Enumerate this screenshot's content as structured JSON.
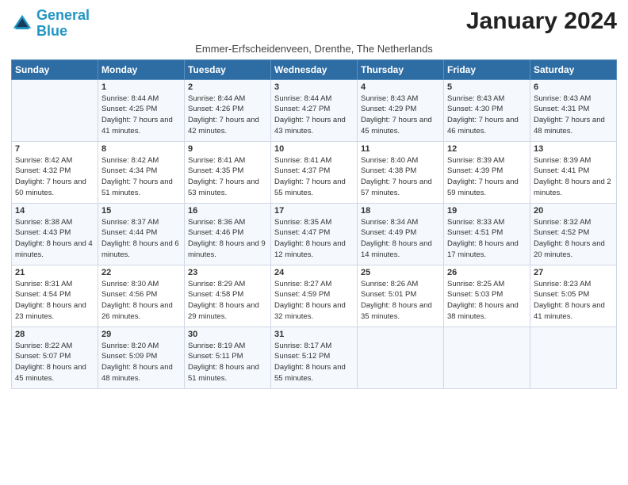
{
  "header": {
    "logo_general": "General",
    "logo_blue": "Blue",
    "month_title": "January 2024",
    "subtitle": "Emmer-Erfscheidenveen, Drenthe, The Netherlands"
  },
  "days_of_week": [
    "Sunday",
    "Monday",
    "Tuesday",
    "Wednesday",
    "Thursday",
    "Friday",
    "Saturday"
  ],
  "weeks": [
    [
      {
        "day": "",
        "sunrise": "",
        "sunset": "",
        "daylight": ""
      },
      {
        "day": "1",
        "sunrise": "Sunrise: 8:44 AM",
        "sunset": "Sunset: 4:25 PM",
        "daylight": "Daylight: 7 hours and 41 minutes."
      },
      {
        "day": "2",
        "sunrise": "Sunrise: 8:44 AM",
        "sunset": "Sunset: 4:26 PM",
        "daylight": "Daylight: 7 hours and 42 minutes."
      },
      {
        "day": "3",
        "sunrise": "Sunrise: 8:44 AM",
        "sunset": "Sunset: 4:27 PM",
        "daylight": "Daylight: 7 hours and 43 minutes."
      },
      {
        "day": "4",
        "sunrise": "Sunrise: 8:43 AM",
        "sunset": "Sunset: 4:29 PM",
        "daylight": "Daylight: 7 hours and 45 minutes."
      },
      {
        "day": "5",
        "sunrise": "Sunrise: 8:43 AM",
        "sunset": "Sunset: 4:30 PM",
        "daylight": "Daylight: 7 hours and 46 minutes."
      },
      {
        "day": "6",
        "sunrise": "Sunrise: 8:43 AM",
        "sunset": "Sunset: 4:31 PM",
        "daylight": "Daylight: 7 hours and 48 minutes."
      }
    ],
    [
      {
        "day": "7",
        "sunrise": "Sunrise: 8:42 AM",
        "sunset": "Sunset: 4:32 PM",
        "daylight": "Daylight: 7 hours and 50 minutes."
      },
      {
        "day": "8",
        "sunrise": "Sunrise: 8:42 AM",
        "sunset": "Sunset: 4:34 PM",
        "daylight": "Daylight: 7 hours and 51 minutes."
      },
      {
        "day": "9",
        "sunrise": "Sunrise: 8:41 AM",
        "sunset": "Sunset: 4:35 PM",
        "daylight": "Daylight: 7 hours and 53 minutes."
      },
      {
        "day": "10",
        "sunrise": "Sunrise: 8:41 AM",
        "sunset": "Sunset: 4:37 PM",
        "daylight": "Daylight: 7 hours and 55 minutes."
      },
      {
        "day": "11",
        "sunrise": "Sunrise: 8:40 AM",
        "sunset": "Sunset: 4:38 PM",
        "daylight": "Daylight: 7 hours and 57 minutes."
      },
      {
        "day": "12",
        "sunrise": "Sunrise: 8:39 AM",
        "sunset": "Sunset: 4:39 PM",
        "daylight": "Daylight: 7 hours and 59 minutes."
      },
      {
        "day": "13",
        "sunrise": "Sunrise: 8:39 AM",
        "sunset": "Sunset: 4:41 PM",
        "daylight": "Daylight: 8 hours and 2 minutes."
      }
    ],
    [
      {
        "day": "14",
        "sunrise": "Sunrise: 8:38 AM",
        "sunset": "Sunset: 4:43 PM",
        "daylight": "Daylight: 8 hours and 4 minutes."
      },
      {
        "day": "15",
        "sunrise": "Sunrise: 8:37 AM",
        "sunset": "Sunset: 4:44 PM",
        "daylight": "Daylight: 8 hours and 6 minutes."
      },
      {
        "day": "16",
        "sunrise": "Sunrise: 8:36 AM",
        "sunset": "Sunset: 4:46 PM",
        "daylight": "Daylight: 8 hours and 9 minutes."
      },
      {
        "day": "17",
        "sunrise": "Sunrise: 8:35 AM",
        "sunset": "Sunset: 4:47 PM",
        "daylight": "Daylight: 8 hours and 12 minutes."
      },
      {
        "day": "18",
        "sunrise": "Sunrise: 8:34 AM",
        "sunset": "Sunset: 4:49 PM",
        "daylight": "Daylight: 8 hours and 14 minutes."
      },
      {
        "day": "19",
        "sunrise": "Sunrise: 8:33 AM",
        "sunset": "Sunset: 4:51 PM",
        "daylight": "Daylight: 8 hours and 17 minutes."
      },
      {
        "day": "20",
        "sunrise": "Sunrise: 8:32 AM",
        "sunset": "Sunset: 4:52 PM",
        "daylight": "Daylight: 8 hours and 20 minutes."
      }
    ],
    [
      {
        "day": "21",
        "sunrise": "Sunrise: 8:31 AM",
        "sunset": "Sunset: 4:54 PM",
        "daylight": "Daylight: 8 hours and 23 minutes."
      },
      {
        "day": "22",
        "sunrise": "Sunrise: 8:30 AM",
        "sunset": "Sunset: 4:56 PM",
        "daylight": "Daylight: 8 hours and 26 minutes."
      },
      {
        "day": "23",
        "sunrise": "Sunrise: 8:29 AM",
        "sunset": "Sunset: 4:58 PM",
        "daylight": "Daylight: 8 hours and 29 minutes."
      },
      {
        "day": "24",
        "sunrise": "Sunrise: 8:27 AM",
        "sunset": "Sunset: 4:59 PM",
        "daylight": "Daylight: 8 hours and 32 minutes."
      },
      {
        "day": "25",
        "sunrise": "Sunrise: 8:26 AM",
        "sunset": "Sunset: 5:01 PM",
        "daylight": "Daylight: 8 hours and 35 minutes."
      },
      {
        "day": "26",
        "sunrise": "Sunrise: 8:25 AM",
        "sunset": "Sunset: 5:03 PM",
        "daylight": "Daylight: 8 hours and 38 minutes."
      },
      {
        "day": "27",
        "sunrise": "Sunrise: 8:23 AM",
        "sunset": "Sunset: 5:05 PM",
        "daylight": "Daylight: 8 hours and 41 minutes."
      }
    ],
    [
      {
        "day": "28",
        "sunrise": "Sunrise: 8:22 AM",
        "sunset": "Sunset: 5:07 PM",
        "daylight": "Daylight: 8 hours and 45 minutes."
      },
      {
        "day": "29",
        "sunrise": "Sunrise: 8:20 AM",
        "sunset": "Sunset: 5:09 PM",
        "daylight": "Daylight: 8 hours and 48 minutes."
      },
      {
        "day": "30",
        "sunrise": "Sunrise: 8:19 AM",
        "sunset": "Sunset: 5:11 PM",
        "daylight": "Daylight: 8 hours and 51 minutes."
      },
      {
        "day": "31",
        "sunrise": "Sunrise: 8:17 AM",
        "sunset": "Sunset: 5:12 PM",
        "daylight": "Daylight: 8 hours and 55 minutes."
      },
      {
        "day": "",
        "sunrise": "",
        "sunset": "",
        "daylight": ""
      },
      {
        "day": "",
        "sunrise": "",
        "sunset": "",
        "daylight": ""
      },
      {
        "day": "",
        "sunrise": "",
        "sunset": "",
        "daylight": ""
      }
    ]
  ]
}
